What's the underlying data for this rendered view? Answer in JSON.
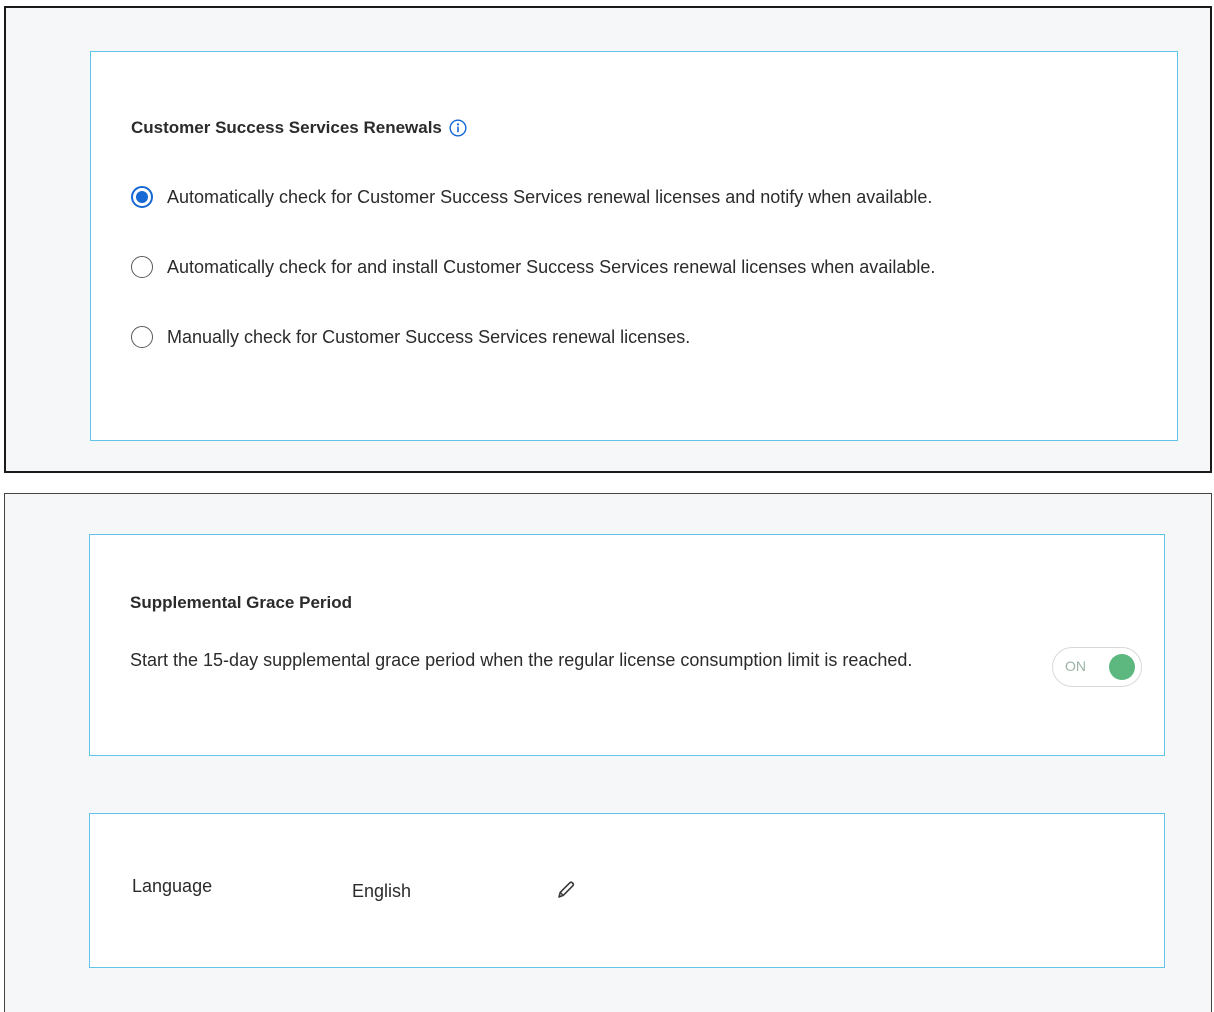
{
  "renewals": {
    "title": "Customer Success Services Renewals",
    "info_icon": "info-icon",
    "options": [
      {
        "label": "Automatically check for Customer Success Services renewal licenses and notify when available.",
        "selected": true
      },
      {
        "label": "Automatically check for and install Customer Success Services renewal licenses when available.",
        "selected": false
      },
      {
        "label": "Manually check for Customer Success Services renewal licenses.",
        "selected": false
      }
    ]
  },
  "grace_period": {
    "title": "Supplemental Grace Period",
    "description": "Start the 15-day supplemental grace period when the regular license consumption limit is reached.",
    "toggle_label": "ON",
    "toggle_on": true
  },
  "language": {
    "label": "Language",
    "value": "English",
    "edit_icon": "pencil-icon"
  },
  "colors": {
    "card_border": "#63c3e8",
    "radio_selected": "#1668d4",
    "toggle_on": "#5cb87f",
    "panel_background": "#f6f7f9"
  }
}
